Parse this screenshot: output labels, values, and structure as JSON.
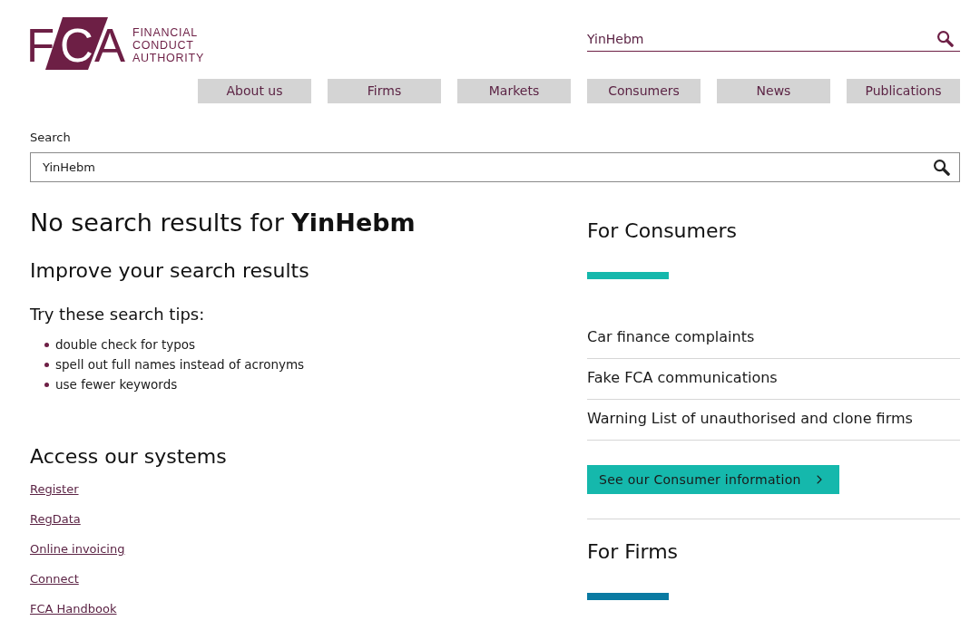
{
  "header": {
    "logo": {
      "letters": [
        "F",
        "C",
        "A"
      ],
      "wordmark": [
        "FINANCIAL",
        "CONDUCT",
        "AUTHORITY"
      ]
    },
    "search": {
      "value": "YinHebm"
    }
  },
  "nav": [
    {
      "label": "About us"
    },
    {
      "label": "Firms"
    },
    {
      "label": "Markets"
    },
    {
      "label": "Consumers"
    },
    {
      "label": "News"
    },
    {
      "label": "Publications"
    }
  ],
  "search": {
    "label": "Search",
    "value": "YinHebm"
  },
  "results": {
    "heading": "No search results for **YinHebm**",
    "subheading": "Improve your search results",
    "tips_heading": "Try these search tips:",
    "tips": [
      "double check for typos",
      "spell out full names instead of acronyms",
      "use fewer keywords"
    ]
  },
  "systems": {
    "heading": "Access our systems",
    "links": [
      "Register",
      "RegData",
      "Online invoicing",
      "Connect",
      "FCA Handbook"
    ]
  },
  "sidebar": {
    "sections": [
      {
        "title": "For Consumers",
        "color": "#15b8ac",
        "links": [
          "Car finance complaints",
          "Fake FCA communications",
          "Warning List of unauthorised and clone firms"
        ],
        "button": "See our Consumer information"
      },
      {
        "title": "For Firms",
        "color": "#0a7aa2"
      }
    ]
  }
}
